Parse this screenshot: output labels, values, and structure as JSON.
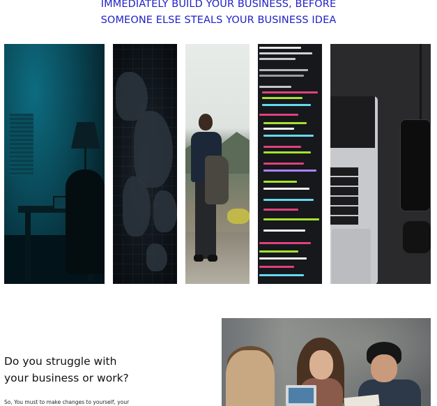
{
  "headline": {
    "line1": "IMMEDIATELY BUILD YOUR BUSINESS, BEFORE",
    "line2": "SOMEONE ELSE STEALS YOUR BUSINESS IDEA",
    "color": "#1e1ec8"
  },
  "gallery": [
    {
      "name": "hacker-at-desk"
    },
    {
      "name": "dark-world-map"
    },
    {
      "name": "man-at-volcano"
    },
    {
      "name": "source-code-screen"
    },
    {
      "name": "laptop-and-phone-desk"
    }
  ],
  "section": {
    "question_line1": "Do you struggle with",
    "question_line2": "your business or work?",
    "body": "So, You must to make changes to yourself, your"
  }
}
